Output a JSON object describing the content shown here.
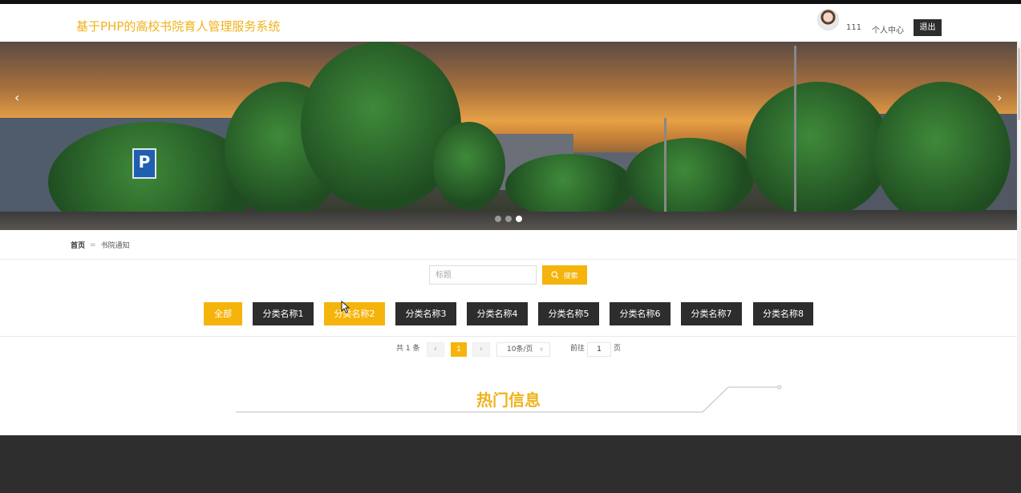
{
  "header": {
    "site_title": "基于PHP的高校书院育人管理服务系统",
    "user_name": "111",
    "user_center_label": "个人中心",
    "logout_label": "退出"
  },
  "banner": {
    "prev_glyph": "‹",
    "next_glyph": "›",
    "slide_count": 3,
    "active_slide": 3
  },
  "breadcrumb": {
    "home": "首页",
    "separator": "=",
    "current": "书院通知"
  },
  "search": {
    "placeholder": "标题",
    "value": "",
    "button_label": "搜索"
  },
  "categories": {
    "items": [
      "全部",
      "分类名称1",
      "分类名称2",
      "分类名称3",
      "分类名称4",
      "分类名称5",
      "分类名称6",
      "分类名称7",
      "分类名称8"
    ],
    "active_index": 0
  },
  "pagination": {
    "total_label": "共 1 条",
    "prev_glyph": "‹",
    "current_page": "1",
    "next_glyph": "›",
    "page_size_label": "10条/页",
    "goto_label": "前往",
    "goto_value": "1",
    "page_suffix": "页"
  },
  "hot_section": {
    "title": "热门信息"
  },
  "colors": {
    "accent": "#f5b40c",
    "title": "#f0b21c",
    "dark_button": "#2d2d2d",
    "footer": "#2e2e2e"
  },
  "icons": [
    "search-icon",
    "chevron-left-icon",
    "chevron-right-icon",
    "chevron-down-icon",
    "avatar"
  ]
}
